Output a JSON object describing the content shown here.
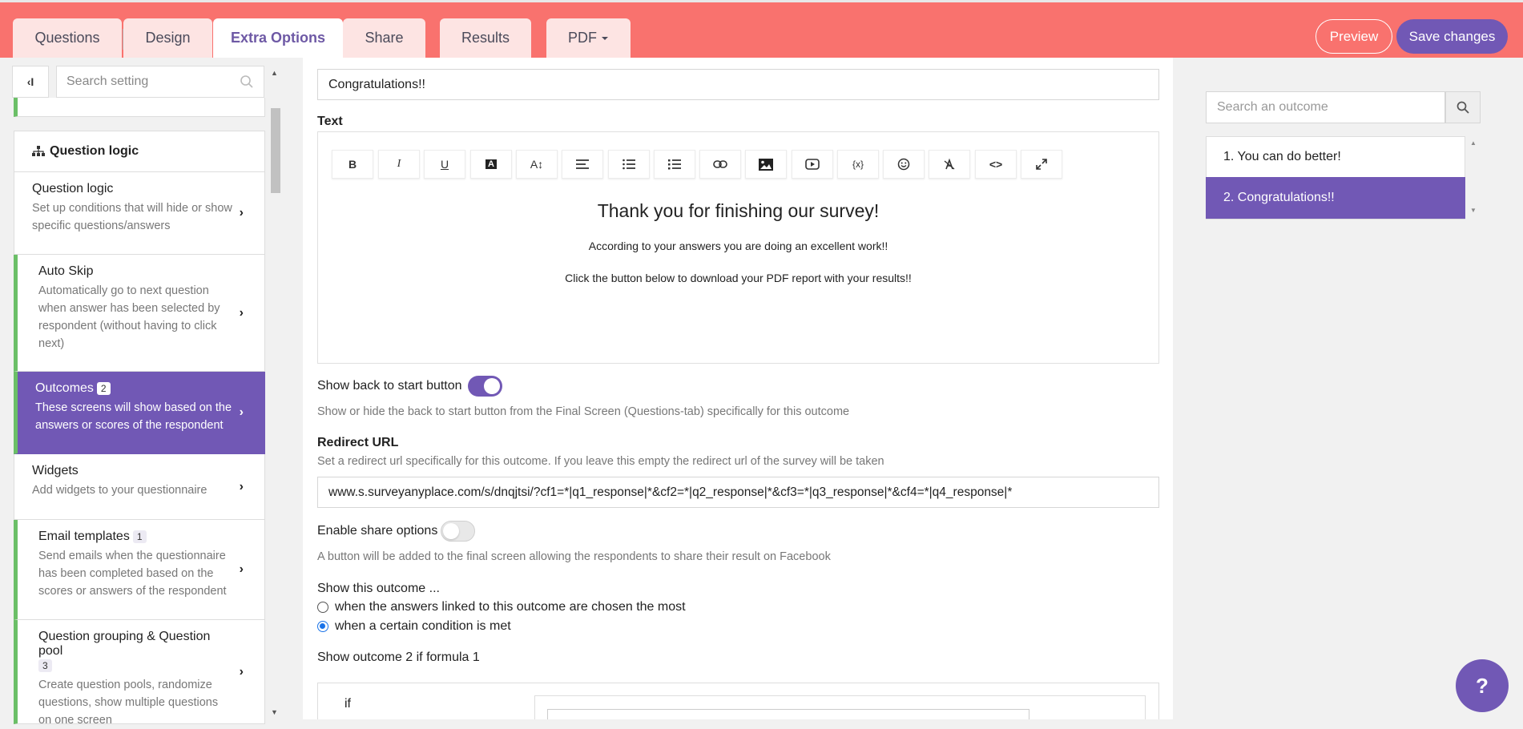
{
  "header": {
    "tabs": [
      {
        "label": "Questions"
      },
      {
        "label": "Design"
      },
      {
        "label": "Extra Options"
      },
      {
        "label": "Share"
      },
      {
        "label": "Results"
      },
      {
        "label": "PDF"
      }
    ],
    "active_tab": "Extra Options",
    "preview_label": "Preview",
    "save_label": "Save changes",
    "accent_color": "#f9726e",
    "primary_color": "#7158b5"
  },
  "sidebar": {
    "collapse_label": "‹I",
    "search_placeholder": "Search setting",
    "section_title": "Question logic",
    "items": [
      {
        "title": "Question logic",
        "badge": "",
        "desc": "Set up conditions that will hide or show specific questions/answers"
      },
      {
        "title": "Auto Skip",
        "badge": "",
        "desc": "Automatically go to next question when answer has been selected by respondent (without having to click next)"
      },
      {
        "title": "Outcomes",
        "badge": "2",
        "desc": "These screens will show based on the answers or scores of the respondent"
      },
      {
        "title": "Widgets",
        "badge": "",
        "desc": "Add widgets to your questionnaire"
      },
      {
        "title": "Email templates",
        "badge": "1",
        "desc": "Send emails when the questionnaire has been completed based on the scores or answers of the respondent"
      },
      {
        "title": "Question grouping & Question pool",
        "badge": "3",
        "desc": "Create question pools, randomize questions, show multiple questions on one screen"
      }
    ]
  },
  "main": {
    "outcome_title_value": "Congratulations!!",
    "text_label": "Text",
    "toolbar_icons": [
      "bold-icon",
      "italic-icon",
      "underline-icon",
      "font-color-icon",
      "font-size-icon",
      "align-icon",
      "ordered-list-icon",
      "unordered-list-icon",
      "link-icon",
      "image-icon",
      "video-icon",
      "variable-icon",
      "emoji-icon",
      "clear-format-icon",
      "code-icon",
      "fullscreen-icon"
    ],
    "editor": {
      "heading": "Thank you for finishing our survey!",
      "line1": "According to your answers you are doing an excellent work!!",
      "line2": "Click the button below to download your PDF report with your results!!"
    },
    "back_to_start_label": "Show back to start button",
    "back_to_start_on": true,
    "back_to_start_help": "Show or hide the back to start button from the Final Screen (Questions-tab) specifically for this outcome",
    "redirect_label": "Redirect URL",
    "redirect_help": "Set a redirect url specifically for this outcome. If you leave this empty the redirect url of the survey will be taken",
    "redirect_value": "www.s.surveyanyplace.com/s/dnqjtsi/?cf1=*|q1_response|*&cf2=*|q2_response|*&cf3=*|q3_response|*&cf4=*|q4_response|*",
    "share_label": "Enable share options",
    "share_on": false,
    "share_help": "A button will be added to the final screen allowing the respondents to share their result on Facebook",
    "show_outcome_label": "Show this outcome ...",
    "radio_options": [
      {
        "label": "when the answers linked to this outcome are chosen the most",
        "selected": false
      },
      {
        "label": "when a certain condition is met",
        "selected": true
      }
    ],
    "formula_label": "Show outcome 2 if formula 1",
    "if_label": "if"
  },
  "outcomes_panel": {
    "search_placeholder": "Search an outcome",
    "items": [
      {
        "label": "1. You can do better!",
        "active": false
      },
      {
        "label": "2. Congratulations!!",
        "active": true
      }
    ]
  },
  "help_button_label": "?"
}
